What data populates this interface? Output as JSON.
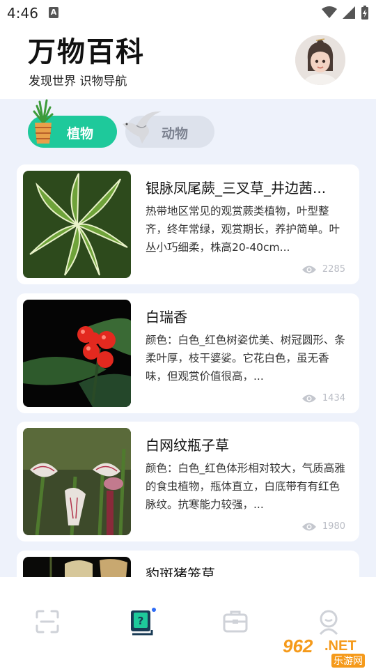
{
  "status_bar": {
    "time": "4:46",
    "notification_icon": "A"
  },
  "header": {
    "title": "万物百科",
    "subtitle": "发现世界 识物导航",
    "avatar_icon": "user-avatar"
  },
  "tabs": [
    {
      "label": "植物",
      "active": true,
      "icon": "potted-plant-icon"
    },
    {
      "label": "动物",
      "active": false,
      "icon": "bird-icon"
    }
  ],
  "cards": [
    {
      "title": "银脉凤尾蕨_三叉草_井边茜...",
      "description": "热带地区常见的观赏蕨类植物，叶型整齐，终年常绿，观赏期长，养护简单。叶丛小巧细柔，株高20-40cm...",
      "views": "2285"
    },
    {
      "title": "白瑞香",
      "description": "颜色：白色_红色树姿优美、树冠圆形、条柔叶厚，枝干婆娑。它花白色，虽无香味，但观赏价值很高，...",
      "views": "1434"
    },
    {
      "title": "白网纹瓶子草",
      "description": "颜色：白色_红色体形相对较大，气质高雅的食虫植物，瓶体直立，白底带有有红色脉纹。抗寒能力较强，...",
      "views": "1980"
    },
    {
      "title": "豹斑猪笼草",
      "description": "",
      "views": ""
    }
  ],
  "bottom_nav": [
    {
      "name": "scan",
      "icon": "scan-icon",
      "active": false
    },
    {
      "name": "encyclopedia",
      "icon": "book-question-icon",
      "active": true
    },
    {
      "name": "toolbox",
      "icon": "briefcase-icon",
      "active": false
    },
    {
      "name": "profile",
      "icon": "person-icon",
      "active": false
    }
  ],
  "watermark": {
    "number": "962",
    "suffix": ".NET",
    "label": "乐游网"
  },
  "colors": {
    "accent": "#1ec99b",
    "background": "#eef2fb",
    "inactive_tab": "#dde2ec",
    "nav_active": "#1a3b55",
    "dot": "#2f6cf6"
  }
}
